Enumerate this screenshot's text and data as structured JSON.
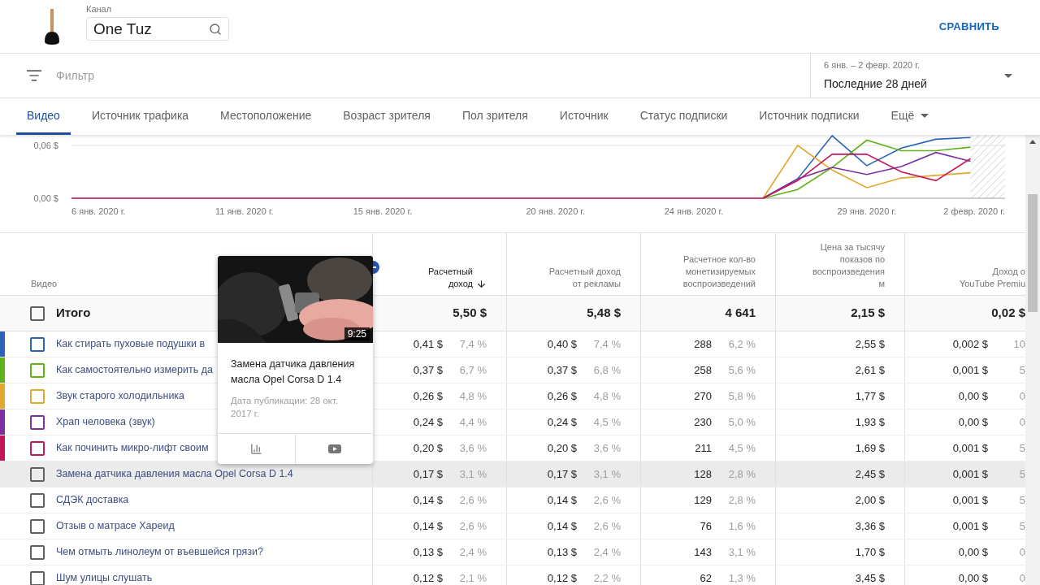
{
  "header": {
    "channel_label": "Канал",
    "channel_search": {
      "value": "One Tuz"
    },
    "compare_button": "СРАВНИТЬ"
  },
  "filter": {
    "placeholder": "Фильтр"
  },
  "date_range": {
    "range": "6 янв. – 2 февр. 2020 г.",
    "label": "Последние 28 дней"
  },
  "tabs": [
    {
      "label": "Видео",
      "selected": true,
      "kind": "tab"
    },
    {
      "label": "Источник трафика",
      "selected": false,
      "kind": "tab"
    },
    {
      "label": "Местоположение",
      "selected": false,
      "kind": "tab"
    },
    {
      "label": "Возраст зрителя",
      "selected": false,
      "kind": "tab"
    },
    {
      "label": "Пол зрителя",
      "selected": false,
      "kind": "tab"
    },
    {
      "label": "Источник",
      "selected": false,
      "kind": "tab"
    },
    {
      "label": "Статус подписки",
      "selected": false,
      "kind": "tab"
    },
    {
      "label": "Источник подписки",
      "selected": false,
      "kind": "tab"
    },
    {
      "label": "Ещё",
      "selected": false,
      "kind": "menu"
    }
  ],
  "chart": {
    "y_labels": [
      "0,06 $",
      "0,00 $"
    ],
    "x_labels": [
      "6 янв. 2020 г.",
      "11 янв. 2020 г.",
      "15 янв. 2020 г.",
      "20 янв. 2020 г.",
      "24 янв. 2020 г.",
      "29 янв. 2020 г.",
      "2 февр. 2020 г."
    ]
  },
  "table": {
    "video_header": "Видео",
    "columns": [
      {
        "lines": [
          "Расчетный",
          "доход"
        ],
        "sorted": true
      },
      {
        "lines": [
          "Расчетный доход",
          "от рекламы"
        ],
        "sorted": false
      },
      {
        "lines": [
          "Расчетное кол-во",
          "монетизируемых",
          "воспроизведений"
        ],
        "sorted": false
      },
      {
        "lines": [
          "Цена за тысячу",
          "показов по",
          "воспроизведения",
          "м"
        ],
        "sorted": false
      },
      {
        "lines": [
          "Доход о",
          "YouTube Premiu"
        ],
        "sorted": false
      }
    ],
    "total": {
      "label": "Итого",
      "checked": false,
      "values": [
        "5,50 $",
        "5,48 $",
        "4 641",
        "2,15 $",
        "0,02 $"
      ]
    },
    "rows": [
      {
        "title": "Как стирать пуховые подушки в",
        "color": "#2a63b8",
        "checked": false,
        "highlighted": false,
        "cells": [
          [
            "0,41 $",
            "7,4 %"
          ],
          [
            "0,40 $",
            "7,4 %"
          ],
          [
            "288",
            "6,2 %"
          ],
          [
            "2,55 $"
          ],
          [
            "0,002 $",
            "10"
          ]
        ]
      },
      {
        "title": "Как самостоятельно измерить да",
        "color": "#5fb31a",
        "checked": false,
        "highlighted": false,
        "cells": [
          [
            "0,37 $",
            "6,7 %"
          ],
          [
            "0,37 $",
            "6,8 %"
          ],
          [
            "258",
            "5,6 %"
          ],
          [
            "2,61 $"
          ],
          [
            "0,001 $",
            "5"
          ]
        ]
      },
      {
        "title": "Звук старого холодильника",
        "color": "#e0a82e",
        "checked": false,
        "highlighted": false,
        "cells": [
          [
            "0,26 $",
            "4,8 %"
          ],
          [
            "0,26 $",
            "4,8 %"
          ],
          [
            "270",
            "5,8 %"
          ],
          [
            "1,77 $"
          ],
          [
            "0,00 $",
            "0"
          ]
        ]
      },
      {
        "title": "Храп человека (звук)",
        "color": "#7b2fa0",
        "checked": false,
        "highlighted": false,
        "cells": [
          [
            "0,24 $",
            "4,4 %"
          ],
          [
            "0,24 $",
            "4,5 %"
          ],
          [
            "230",
            "5,0 %"
          ],
          [
            "1,93 $"
          ],
          [
            "0,00 $",
            "0"
          ]
        ]
      },
      {
        "title": "Как починить микро-лифт своим",
        "color": "#c2185b",
        "checked": false,
        "highlighted": false,
        "cells": [
          [
            "0,20 $",
            "3,6 %"
          ],
          [
            "0,20 $",
            "3,6 %"
          ],
          [
            "211",
            "4,5 %"
          ],
          [
            "1,69 $"
          ],
          [
            "0,001 $",
            "5"
          ]
        ]
      },
      {
        "title": "Замена датчика давления масла Opel Corsa D 1.4",
        "checked": false,
        "highlighted": true,
        "cells": [
          [
            "0,17 $",
            "3,1 %"
          ],
          [
            "0,17 $",
            "3,1 %"
          ],
          [
            "128",
            "2,8 %"
          ],
          [
            "2,45 $"
          ],
          [
            "0,001 $",
            "5"
          ]
        ]
      },
      {
        "title": "СДЭК доставка",
        "checked": false,
        "highlighted": false,
        "cells": [
          [
            "0,14 $",
            "2,6 %"
          ],
          [
            "0,14 $",
            "2,6 %"
          ],
          [
            "129",
            "2,8 %"
          ],
          [
            "2,00 $"
          ],
          [
            "0,001 $",
            "5"
          ]
        ]
      },
      {
        "title": "Отзыв о матрасе Хареид",
        "checked": false,
        "highlighted": false,
        "cells": [
          [
            "0,14 $",
            "2,6 %"
          ],
          [
            "0,14 $",
            "2,6 %"
          ],
          [
            "76",
            "1,6 %"
          ],
          [
            "3,36 $"
          ],
          [
            "0,001 $",
            "5"
          ]
        ]
      },
      {
        "title": "Чем отмыть линолеум от въевшейся грязи?",
        "checked": false,
        "highlighted": false,
        "cells": [
          [
            "0,13 $",
            "2,4 %"
          ],
          [
            "0,13 $",
            "2,4 %"
          ],
          [
            "143",
            "3,1 %"
          ],
          [
            "1,70 $"
          ],
          [
            "0,00 $",
            "0"
          ]
        ]
      },
      {
        "title": "Шум улицы слушать",
        "checked": false,
        "highlighted": false,
        "cells": [
          [
            "0,12 $",
            "2,1 %"
          ],
          [
            "0,12 $",
            "2,2 %"
          ],
          [
            "62",
            "1,3 %"
          ],
          [
            "3,45 $"
          ],
          [
            "0,00 $",
            "0"
          ]
        ]
      }
    ]
  },
  "preview_card": {
    "duration": "9:25",
    "title": "Замена датчика давления масла Opel Corsa D 1.4",
    "date": "Дата публикации: 28 окт. 2017 г."
  }
}
